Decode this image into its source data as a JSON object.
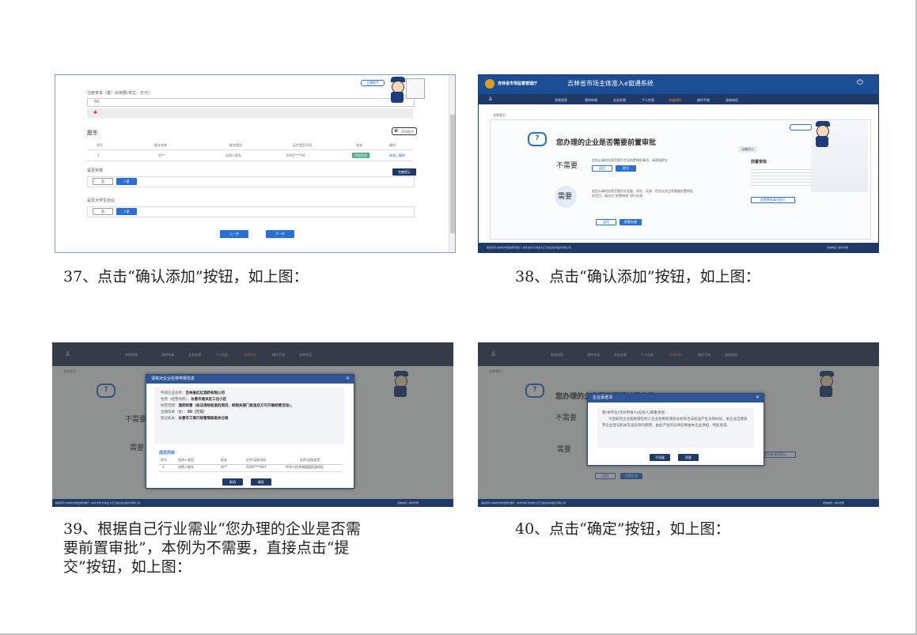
{
  "captions": {
    "c37": "37、点击“确认添加”按钮，如上图：",
    "c38": "38、点击“确认添加”按钮，如上图：",
    "c39_l1": "39、根据自己行业需业“您办理的企业是否需",
    "c39_l2": "要前置审批”，本例为不需要，直接点击“提",
    "c39_l3": "交”按钮，如上图：",
    "c40": "40、点击“确定”按钮，如上图："
  },
  "shot37": {
    "field_label": "注册资本（金）出资额(单位：万元)",
    "field_value": "50",
    "section_shareholders": "股东",
    "add_label": "添加股东",
    "cols": [
      "序号",
      "股东名称",
      "股东类型",
      "证件类型号码",
      "状态",
      "操作"
    ],
    "row": [
      "1",
      "刘**",
      "自然人股东",
      "2202****34",
      "添加完成",
      "修改 | 删除"
    ],
    "q_supervisor": "是否实缴",
    "q_student": "是否大学生创业",
    "yes": "是",
    "no": "否",
    "prev": "上一步",
    "next": "下一步",
    "badge": "主播助手",
    "scroll_btn": "完善提示"
  },
  "header": {
    "org": "吉林省市场监督管理厅",
    "system": "吉林省市场主体准入e窗通系统",
    "nav": [
      "系统消息",
      "我的申请",
      "业务办理",
      "个人信息",
      "申请材料",
      "操作手册",
      "咨询电话"
    ],
    "active_nav": "申请材料",
    "crumb": "名称登记",
    "footer_left": "版权所有:吉林省市场监督管理厅 | 技术支持:长春吉大正元信息技术股份有限公司",
    "footer_right": "咨询电话 | 操作手册"
  },
  "shot38": {
    "question": "您办理的企业是否需要前置审批",
    "no_need": "不需要",
    "need": "需要",
    "no_text": "若您从事的经营范围不涉及前置审批事项，请直接提交",
    "need_text": "若您从事的经营范围涉及金融、保险、证券、危险化学品等需要前置审批的项目，请点击“前置审批”进行办理",
    "return": "返回",
    "submit": "提交",
    "pre_approval": "前置办理",
    "side_title": "前置审批",
    "side_tab": "温馨提示",
    "side_btn": "前置审批事项提示"
  },
  "shot39": {
    "title": "请核对企业名称申报信息",
    "name_label": "申请企业名称：",
    "name_value": "吉林省红红酒药有限公司",
    "addr_label": "住所（经营场所）：",
    "addr_value": "长春市南关区三岔小区",
    "scope_label": "经营范围：",
    "scope_value": "酒药经营（依法须经批准的项目，经相关部门批准后方可开展经营活动）。",
    "capital_label": "注册资本（金）：",
    "capital_value": "50（万元）",
    "auth_label": "登记机关：",
    "auth_value": "长春市工商行政管理局南关分局",
    "members_title": "成员列表",
    "cols": [
      "序号",
      "投资人类型",
      "姓名",
      "证件/证照号码",
      "证件/证照类型"
    ],
    "row": [
      "1",
      "自然人股东",
      "刘**",
      "2202****817",
      "中华人民共和国居民身份证"
    ],
    "cancel": "取消",
    "confirm": "确定"
  },
  "shot40": {
    "title": "企业承诺书",
    "line1": "我(本单位)作为申请人(投资人)郑重承诺：",
    "line2": "今后如因企业名称侵犯他人企业名称权或商号权等合法权益产生法律纠纷，本企业自愿放弃企业登记机关及该名称的使用，由此产生的法律后果由本企业承担，特此承诺。",
    "disagree": "不同意",
    "agree": "同意"
  }
}
